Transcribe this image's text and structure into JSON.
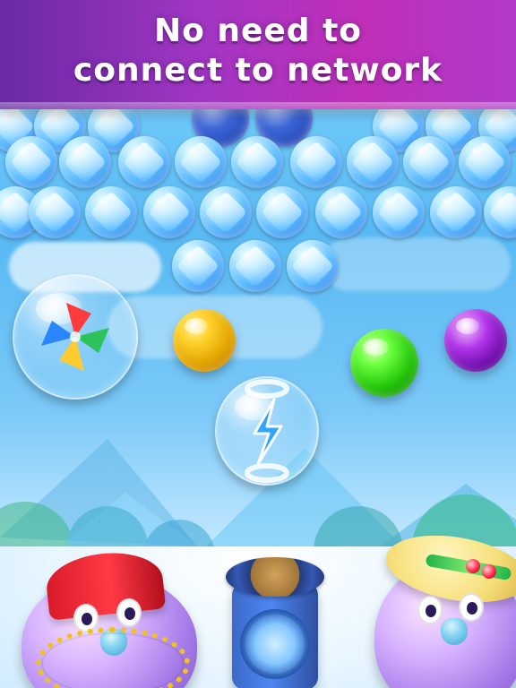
{
  "banner": {
    "line1": "No need to",
    "line2": "connect to network"
  },
  "colors": {
    "banner_left": "#6a2aa6",
    "banner_right": "#b13acb",
    "sky": "#58b9f3",
    "gem_blue": "#55b8ff",
    "bubble_yellow": "#ffd229",
    "bubble_green": "#24c40a",
    "bubble_purple": "#6a0aa8"
  },
  "game": {
    "pinwheel_powerup_icon": "pinwheel-icon",
    "lightning_powerup_icon": "lightning-icon"
  }
}
